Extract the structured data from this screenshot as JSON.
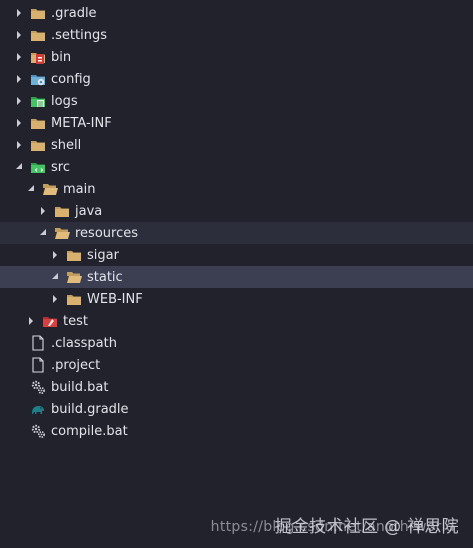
{
  "tree": {
    "items": [
      {
        "label": ".gradle",
        "icon": "folder-icon"
      },
      {
        "label": ".settings",
        "icon": "folder-icon"
      },
      {
        "label": "bin",
        "icon": "folder-bin-icon"
      },
      {
        "label": "config",
        "icon": "folder-config-icon"
      },
      {
        "label": "logs",
        "icon": "folder-logs-icon"
      },
      {
        "label": "META-INF",
        "icon": "folder-icon"
      },
      {
        "label": "shell",
        "icon": "folder-icon"
      },
      {
        "label": "src",
        "icon": "folder-src-icon"
      },
      {
        "label": "main",
        "icon": "folder-open-icon"
      },
      {
        "label": "java",
        "icon": "folder-icon"
      },
      {
        "label": "resources",
        "icon": "folder-open-icon"
      },
      {
        "label": "sigar",
        "icon": "folder-icon"
      },
      {
        "label": "static",
        "icon": "folder-open-icon"
      },
      {
        "label": "WEB-INF",
        "icon": "folder-icon"
      },
      {
        "label": "test",
        "icon": "folder-test-icon"
      },
      {
        "label": ".classpath",
        "icon": "file-icon"
      },
      {
        "label": ".project",
        "icon": "file-icon"
      },
      {
        "label": "build.bat",
        "icon": "gear-file-icon"
      },
      {
        "label": "build.gradle",
        "icon": "gradle-elephant-icon"
      },
      {
        "label": "compile.bat",
        "icon": "gear-file-icon"
      }
    ]
  },
  "watermark": {
    "text": "掘金技术社区 @ 禅思院",
    "url": "https://blog.csdn.net/anothrworld"
  },
  "colors": {
    "background": "#21222c",
    "highlight_row": "#2c2f3b",
    "selected_row": "#3b3f51",
    "folder": "#c8a060",
    "text": "#e2e4ea"
  }
}
